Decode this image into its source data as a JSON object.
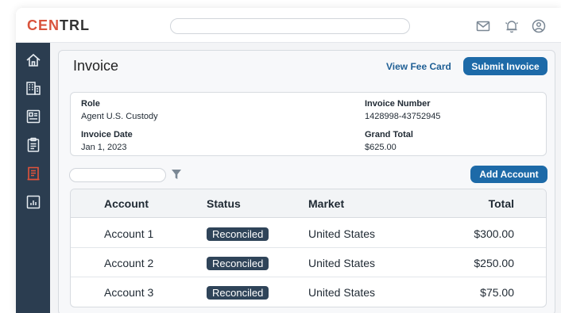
{
  "app": {
    "logo_prefix": "CEN",
    "logo_suffix": "TRL"
  },
  "search": {
    "placeholder": ""
  },
  "topbar_icons": [
    "mail-icon",
    "bell-icon",
    "user-icon"
  ],
  "sidebar": {
    "items": [
      {
        "name": "home-icon",
        "active": false
      },
      {
        "name": "building-icon",
        "active": false
      },
      {
        "name": "id-card-icon",
        "active": false
      },
      {
        "name": "clipboard-icon",
        "active": false
      },
      {
        "name": "invoice-icon",
        "active": true
      },
      {
        "name": "report-icon",
        "active": false
      }
    ]
  },
  "header": {
    "title": "Invoice",
    "view_fee_card": "View Fee Card",
    "submit_invoice": "Submit Invoice"
  },
  "details": {
    "role_label": "Role",
    "role_value": "Agent U.S. Custody",
    "invoice_number_label": "Invoice Number",
    "invoice_number_value": "1428998-43752945",
    "invoice_date_label": "Invoice Date",
    "invoice_date_value": "Jan 1, 2023",
    "grand_total_label": "Grand Total",
    "grand_total_value": "$625.00"
  },
  "filter": {
    "placeholder": ""
  },
  "add_account": "Add Account",
  "table": {
    "columns": [
      "Account",
      "Status",
      "Market",
      "Total"
    ],
    "rows": [
      {
        "account": "Account 1",
        "status": "Reconciled",
        "market": "United States",
        "total": "$300.00"
      },
      {
        "account": "Account 2",
        "status": "Reconciled",
        "market": "United States",
        "total": "$250.00"
      },
      {
        "account": "Account 3",
        "status": "Reconciled",
        "market": "United States",
        "total": "$75.00"
      }
    ]
  },
  "colors": {
    "accent": "#d9533c",
    "primary_button": "#1d6aa8",
    "sidebar": "#2b3d50",
    "badge": "#2f4459"
  }
}
